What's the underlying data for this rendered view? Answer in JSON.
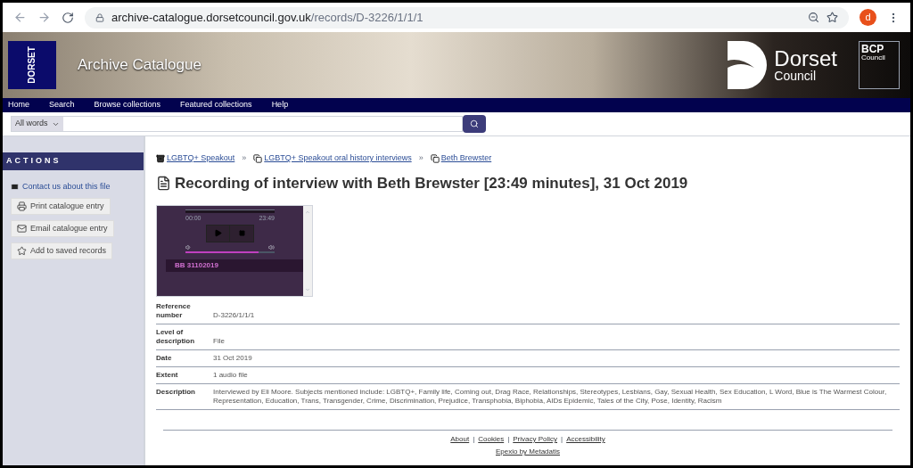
{
  "browser": {
    "url_host": "archive-catalogue.dorsetcouncil.gov.uk",
    "url_path": "/records/D-3226/1/1/1",
    "profile": "d"
  },
  "header": {
    "logo_text": "DORSET",
    "title": "Archive Catalogue",
    "council_name": "Dorset",
    "council_sub": "Council",
    "bcp": "BCP",
    "bcp_sub": "Council"
  },
  "nav": [
    {
      "label": "Home"
    },
    {
      "label": "Search"
    },
    {
      "label": "Browse collections"
    },
    {
      "label": "Featured collections"
    },
    {
      "label": "Help"
    }
  ],
  "search": {
    "mode": "All words"
  },
  "sidebar": {
    "heading": "ACTIONS",
    "contact": "Contact us about this file",
    "buttons": [
      {
        "kind": "print",
        "label": "Print catalogue entry"
      },
      {
        "kind": "email",
        "label": "Email catalogue entry"
      },
      {
        "kind": "star",
        "label": "Add to saved records"
      }
    ]
  },
  "breadcrumbs": [
    {
      "kind": "archive",
      "label": "LGBTQ+ Speakout"
    },
    {
      "kind": "copy",
      "label": "LGBTQ+ Speakout oral history interviews"
    },
    {
      "kind": "copy",
      "label": "Beth Brewster"
    }
  ],
  "breadcrumb_separator": "»",
  "title": "Recording of interview with Beth Brewster [23:49 minutes], 31 Oct 2019",
  "player": {
    "start": "00:00",
    "end": "23:49",
    "volume": {
      "level": 0.82
    },
    "track": "BB 31102019"
  },
  "fields": [
    {
      "label": "Reference number",
      "value": "D-3226/1/1/1"
    },
    {
      "label": "Level of description",
      "value": "File"
    },
    {
      "label": "Date",
      "value": "31 Oct 2019"
    },
    {
      "label": "Extent",
      "value": "1 audio file"
    },
    {
      "label": "Description",
      "value": "Interviewed by Eli Moore. Subjects mentioned include: LGBTQ+, Family life, Coming out, Drag Race, Relationships, Stereotypes, Lesbians, Gay, Sexual Health, Sex Education, L Word, Blue is The Warmest Colour, Representation, Education, Trans, Transgender, Crime, Discrimination, Prejudice, Transphobia, Biphobia, AIDs Epidemic, Tales of the City, Pose, Identity, Racism"
    }
  ],
  "footer": {
    "links": [
      {
        "label": "About"
      },
      {
        "label": "Cookies"
      },
      {
        "label": "Privacy Policy"
      },
      {
        "label": "Accessibility"
      }
    ],
    "separator": "|",
    "credit": "Epexio by Metadatis"
  }
}
